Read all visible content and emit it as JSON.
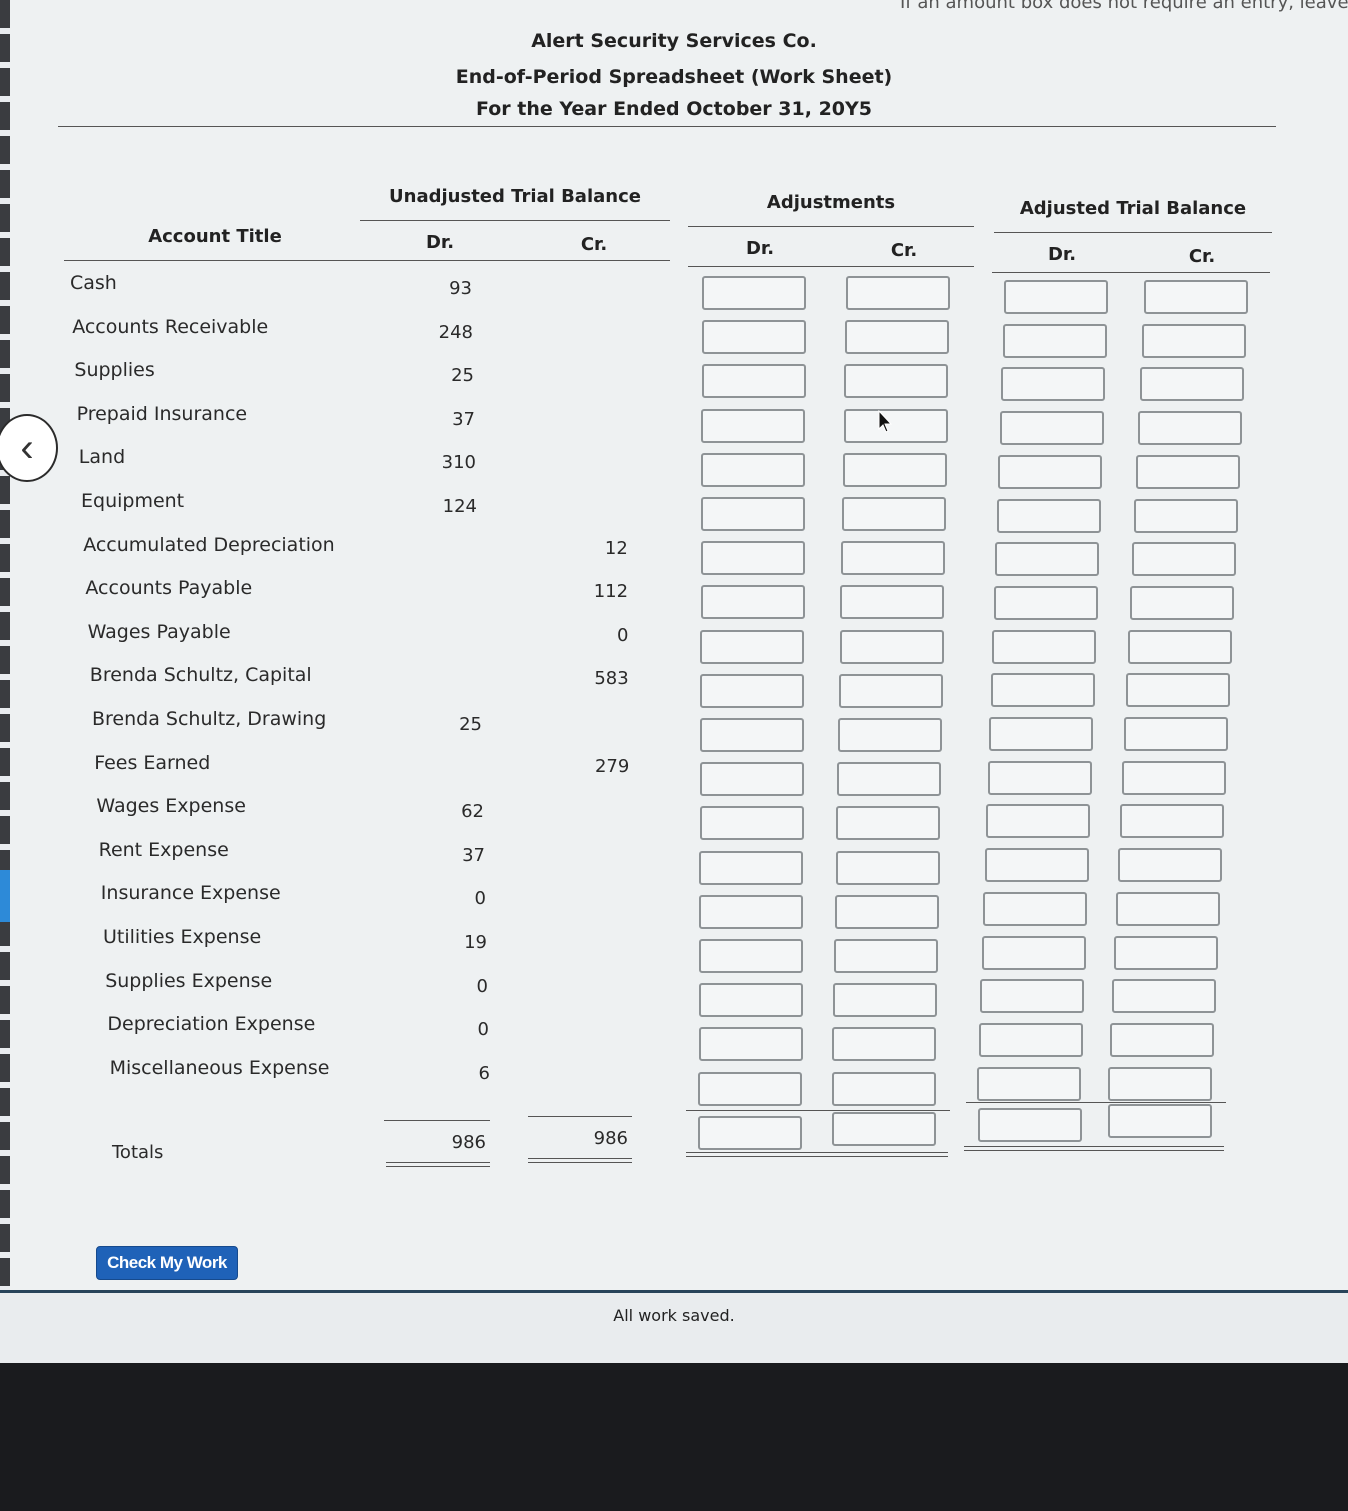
{
  "instruction_fragment": "If an amount box does not require an entry, leave",
  "header": {
    "company": "Alert Security Services Co.",
    "title": "End-of-Period Spreadsheet (Work Sheet)",
    "period": "For the Year Ended October 31, 20Y5"
  },
  "columns": {
    "account_title": "Account Title",
    "unadjusted": "Unadjusted Trial Balance",
    "adjustments": "Adjustments",
    "adjusted": "Adjusted Trial Balance",
    "dr": "Dr.",
    "cr": "Cr."
  },
  "rows": [
    {
      "account": "Cash",
      "dr": "93",
      "cr": ""
    },
    {
      "account": "Accounts Receivable",
      "dr": "248",
      "cr": ""
    },
    {
      "account": "Supplies",
      "dr": "25",
      "cr": ""
    },
    {
      "account": "Prepaid Insurance",
      "dr": "37",
      "cr": ""
    },
    {
      "account": "Land",
      "dr": "310",
      "cr": ""
    },
    {
      "account": "Equipment",
      "dr": "124",
      "cr": ""
    },
    {
      "account": "Accumulated Depreciation",
      "dr": "",
      "cr": "12"
    },
    {
      "account": "Accounts Payable",
      "dr": "",
      "cr": "112"
    },
    {
      "account": "Wages Payable",
      "dr": "",
      "cr": "0"
    },
    {
      "account": "Brenda Schultz, Capital",
      "dr": "",
      "cr": "583"
    },
    {
      "account": "Brenda Schultz, Drawing",
      "dr": "25",
      "cr": ""
    },
    {
      "account": "Fees Earned",
      "dr": "",
      "cr": "279"
    },
    {
      "account": "Wages Expense",
      "dr": "62",
      "cr": ""
    },
    {
      "account": "Rent Expense",
      "dr": "37",
      "cr": ""
    },
    {
      "account": "Insurance Expense",
      "dr": "0",
      "cr": ""
    },
    {
      "account": "Utilities Expense",
      "dr": "19",
      "cr": ""
    },
    {
      "account": "Supplies Expense",
      "dr": "0",
      "cr": ""
    },
    {
      "account": "Depreciation Expense",
      "dr": "0",
      "cr": ""
    },
    {
      "account": "Miscellaneous Expense",
      "dr": "6",
      "cr": ""
    }
  ],
  "totals": {
    "label": "Totals",
    "dr": "986",
    "cr": "986"
  },
  "check_button": "Check My Work",
  "status": "All work saved."
}
